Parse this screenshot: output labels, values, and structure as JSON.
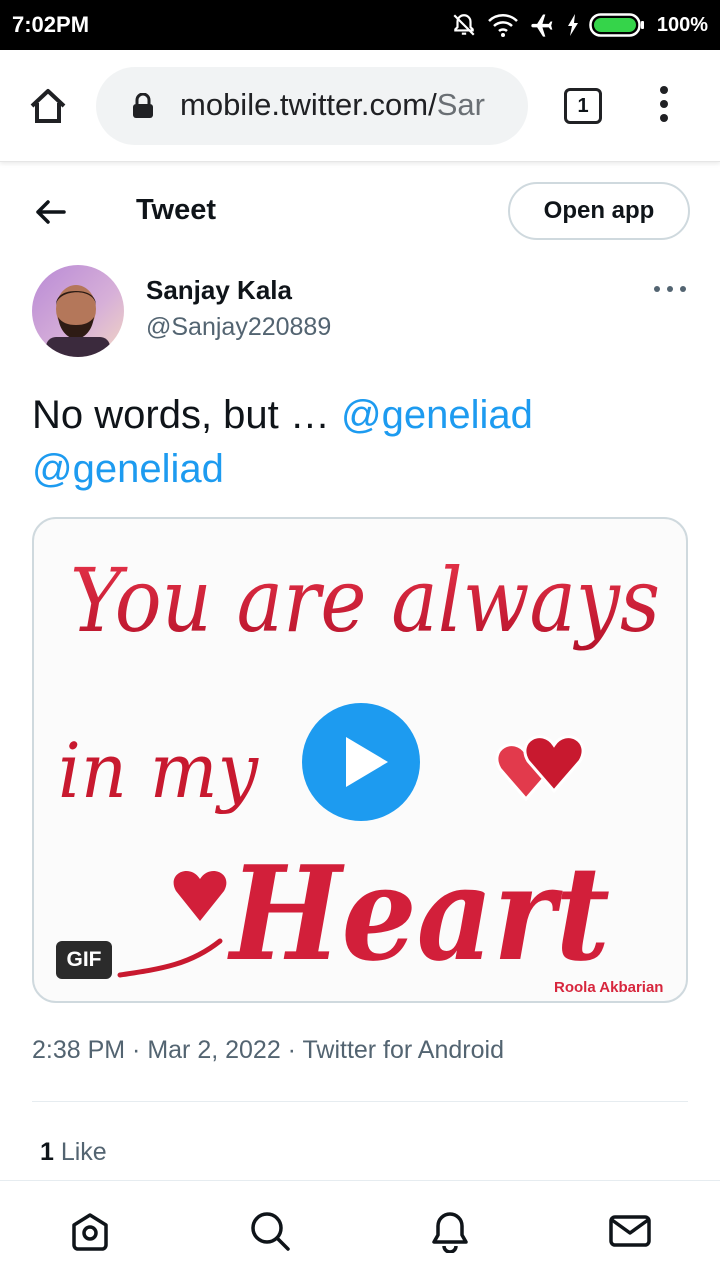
{
  "status_bar": {
    "time": "7:02PM",
    "battery_percent": "100%",
    "icons": [
      "bell-off-icon",
      "wifi-icon",
      "airplane-icon",
      "charging-icon",
      "battery-icon"
    ]
  },
  "browser": {
    "url_visible": "mobile.twitter.com/",
    "url_rest": "Sar",
    "tab_count": "1",
    "icons": [
      "home-icon",
      "lock-icon",
      "menu-dots-icon"
    ]
  },
  "header": {
    "title": "Tweet",
    "open_app_label": "Open app"
  },
  "tweet": {
    "author_name": "Sanjay Kala",
    "author_handle": "@Sanjay220889",
    "text_prefix": "No words, but … ",
    "mentions": [
      "@geneliad",
      "@geneliad"
    ],
    "media": {
      "badge": "GIF",
      "line1": "You are always",
      "line2": "in my",
      "line3": "Heart",
      "credit": "Roola Akbarian"
    },
    "meta": "2:38 PM · Mar 2, 2022 · Twitter for Android",
    "like_count": "1",
    "like_label": " Like"
  },
  "bottom_nav": [
    "home-icon",
    "search-icon",
    "notifications-icon",
    "messages-icon"
  ],
  "colors": {
    "accent": "#1d9bf0",
    "text": "#0f1419",
    "secondary": "#536471",
    "gif_red": "#d7263d"
  }
}
